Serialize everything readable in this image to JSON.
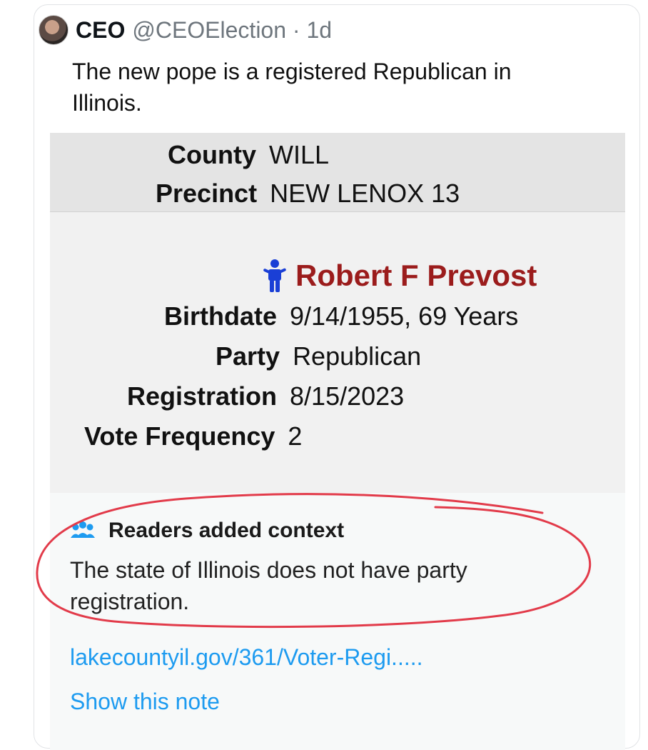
{
  "tweet": {
    "author_name": "CEO",
    "handle_time": "@CEOElection · 1d",
    "text": "The new pope is a registered Republican in Illinois."
  },
  "record": {
    "county_label": "County",
    "county_value": "WILL",
    "precinct_label": "Precinct",
    "precinct_value": "NEW LENOX 13",
    "voter_name": "Robert F Prevost",
    "birthdate_label": "Birthdate",
    "birthdate_value": "9/14/1955, 69 Years",
    "party_label": "Party",
    "party_value": "Republican",
    "registration_label": "Registration",
    "registration_value": "8/15/2023",
    "vote_frequency_label": "Vote Frequency",
    "vote_frequency_value": "2"
  },
  "community_note": {
    "title": "Readers added context",
    "body": "The state of Illinois does not have party registration.",
    "link": "lakecountyil.gov/361/Voter-Regi.....",
    "show_note": "Show this note"
  },
  "icons": {
    "avatar": "profile-photo",
    "person": "person-icon",
    "readers": "people-group-icon"
  },
  "colors": {
    "voter_name": "#9b1c1c",
    "person_icon": "#1a3fd6",
    "link": "#1d9bf0",
    "annotation_circle": "#e23b4a"
  }
}
